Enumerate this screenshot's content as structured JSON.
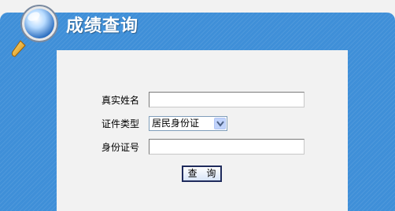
{
  "header": {
    "title": "成绩查询"
  },
  "form": {
    "name_label": "真实姓名",
    "name_value": "",
    "id_type_label": "证件类型",
    "id_type_selected": "居民身份证",
    "id_number_label": "身份证号",
    "id_number_value": ""
  },
  "actions": {
    "query_label": "查 询"
  },
  "colors": {
    "panel_blue": "#3f8fd8",
    "form_bg": "#f2f2f2",
    "button_border": "#1f2b5c"
  },
  "icons": {
    "header_icon": "magnifier-icon",
    "select_icon": "chevron-down-icon"
  }
}
